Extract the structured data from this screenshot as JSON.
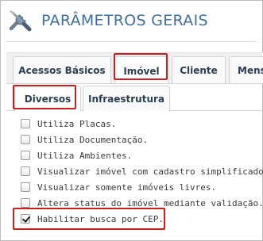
{
  "header": {
    "title": "PARÂMETROS GERAIS",
    "icon": "tools-icon"
  },
  "main_tabs": [
    {
      "label": "Acessos Básicos",
      "active": false
    },
    {
      "label": "Imóvel",
      "active": true
    },
    {
      "label": "Cliente",
      "active": false
    },
    {
      "label": "Mens",
      "active": false
    }
  ],
  "sub_tabs": [
    {
      "label": "Diversos",
      "active": true
    },
    {
      "label": "Infraestrutura",
      "active": false
    }
  ],
  "options": [
    {
      "label": "Utiliza Placas.",
      "checked": false
    },
    {
      "label": "Utiliza Documentação.",
      "checked": false
    },
    {
      "label": "Utiliza Ambientes.",
      "checked": false
    },
    {
      "label": "Visualizar imóvel com cadastro simplificado.",
      "checked": false
    },
    {
      "label": "Visualizar somente imóveis livres.",
      "checked": false
    },
    {
      "label": "Altera status do imóvel mediante validação.",
      "checked": false
    },
    {
      "label": "Habilitar busca por CEP.",
      "checked": true
    }
  ],
  "colors": {
    "title": "#3f6fa0",
    "highlight": "#d11c1c",
    "tab_text": "#2a3f55"
  }
}
